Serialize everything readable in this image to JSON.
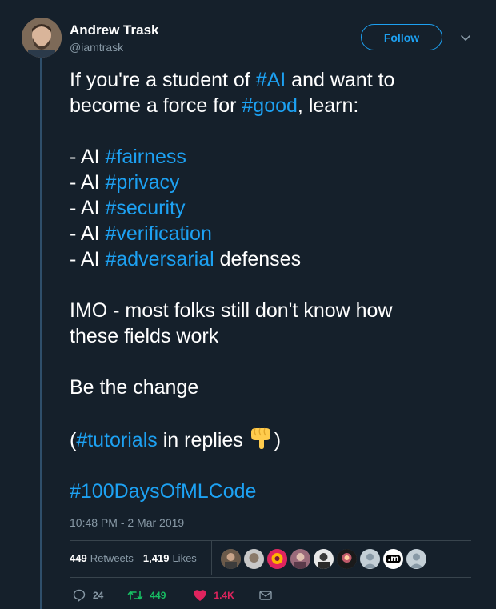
{
  "author": {
    "name": "Andrew Trask",
    "handle": "@iamtrask",
    "follow_label": "Follow"
  },
  "tweet": {
    "line1_a": "If you're a student of ",
    "line1_tag": "#AI",
    "line1_b": " and want to",
    "line2_a": "become a force for ",
    "line2_tag": "#good",
    "line2_b": ", learn:",
    "list": [
      {
        "prefix": "- AI ",
        "tag": "#fairness",
        "suffix": ""
      },
      {
        "prefix": "- AI ",
        "tag": "#privacy",
        "suffix": ""
      },
      {
        "prefix": "- AI ",
        "tag": "#security",
        "suffix": ""
      },
      {
        "prefix": "- AI ",
        "tag": "#verification",
        "suffix": ""
      },
      {
        "prefix": "- AI ",
        "tag": "#adversarial",
        "suffix": " defenses"
      }
    ],
    "imo_line1": "IMO - most folks still don't know how",
    "imo_line2": "these fields work",
    "change": "Be the change",
    "tutorials_open": "(",
    "tutorials_tag": "#tutorials",
    "tutorials_text": " in replies ",
    "tutorials_close": ")",
    "final_tag": "#100DaysOfMLCode"
  },
  "timestamp": "10:48 PM - 2 Mar 2019",
  "stats": {
    "retweets_count": "449",
    "retweets_label": "Retweets",
    "likes_count": "1,419",
    "likes_label": "Likes"
  },
  "actions": {
    "reply_count": "24",
    "retweet_count": "449",
    "like_count": "1.4K"
  },
  "colors": {
    "background": "#15202b",
    "accent": "#1da1f2",
    "retweet_green": "#17bf63",
    "like_red": "#e0245e",
    "muted": "#8899a6"
  },
  "liker_label": ".m"
}
